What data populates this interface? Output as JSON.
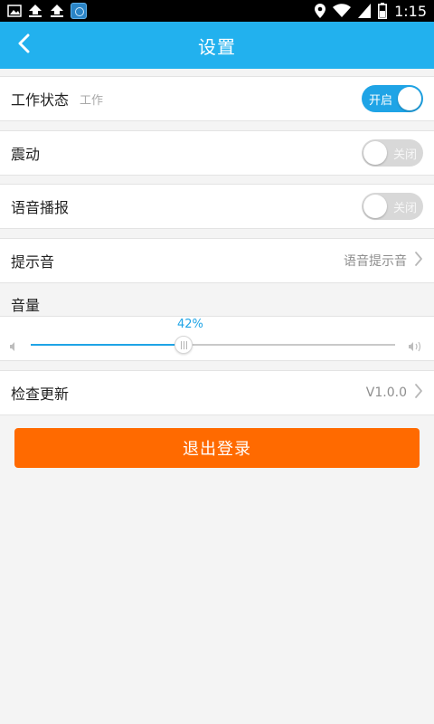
{
  "status_bar": {
    "time": "1:15",
    "icons_left": [
      "image-icon",
      "upload-icon",
      "upload-icon",
      "app-icon"
    ],
    "icons_right": [
      "location-icon",
      "wifi-icon",
      "signal-icon",
      "battery-icon"
    ]
  },
  "header": {
    "title": "设置",
    "back_icon": "chevron-left-icon",
    "color": "#22b1ee"
  },
  "settings": {
    "work_status": {
      "label": "工作状态",
      "sub": "工作",
      "toggle_text": "开启",
      "on": true
    },
    "vibrate": {
      "label": "震动",
      "toggle_text": "关闭",
      "on": false
    },
    "voice": {
      "label": "语音播报",
      "toggle_text": "关闭",
      "on": false
    },
    "tone": {
      "label": "提示音",
      "value": "语音提示音"
    },
    "volume": {
      "label": "音量",
      "percent_text": "42%",
      "value": 0.42
    },
    "update": {
      "label": "检查更新",
      "value": "V1.0.0"
    }
  },
  "logout": {
    "label": "退出登录",
    "color": "#ff6a00"
  },
  "colors": {
    "accent": "#1fa4e6",
    "toggle_off": "#d8d8d8"
  }
}
